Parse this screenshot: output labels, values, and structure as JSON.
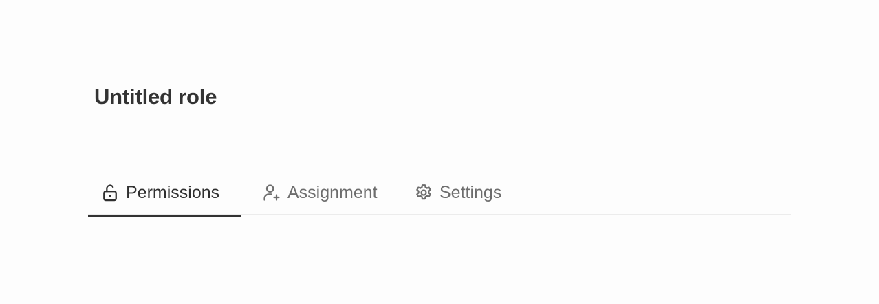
{
  "header": {
    "title": "Untitled role"
  },
  "tabs": [
    {
      "label": "Permissions",
      "icon": "unlock-icon",
      "active": true
    },
    {
      "label": "Assignment",
      "icon": "user-plus-icon",
      "active": false
    },
    {
      "label": "Settings",
      "icon": "gear-icon",
      "active": false
    }
  ],
  "colors": {
    "background": "#fdfdfd",
    "text_primary": "#2f2f2f",
    "text_inactive": "#6d6d6d",
    "active_underline": "#333333",
    "divider": "#ececec"
  }
}
